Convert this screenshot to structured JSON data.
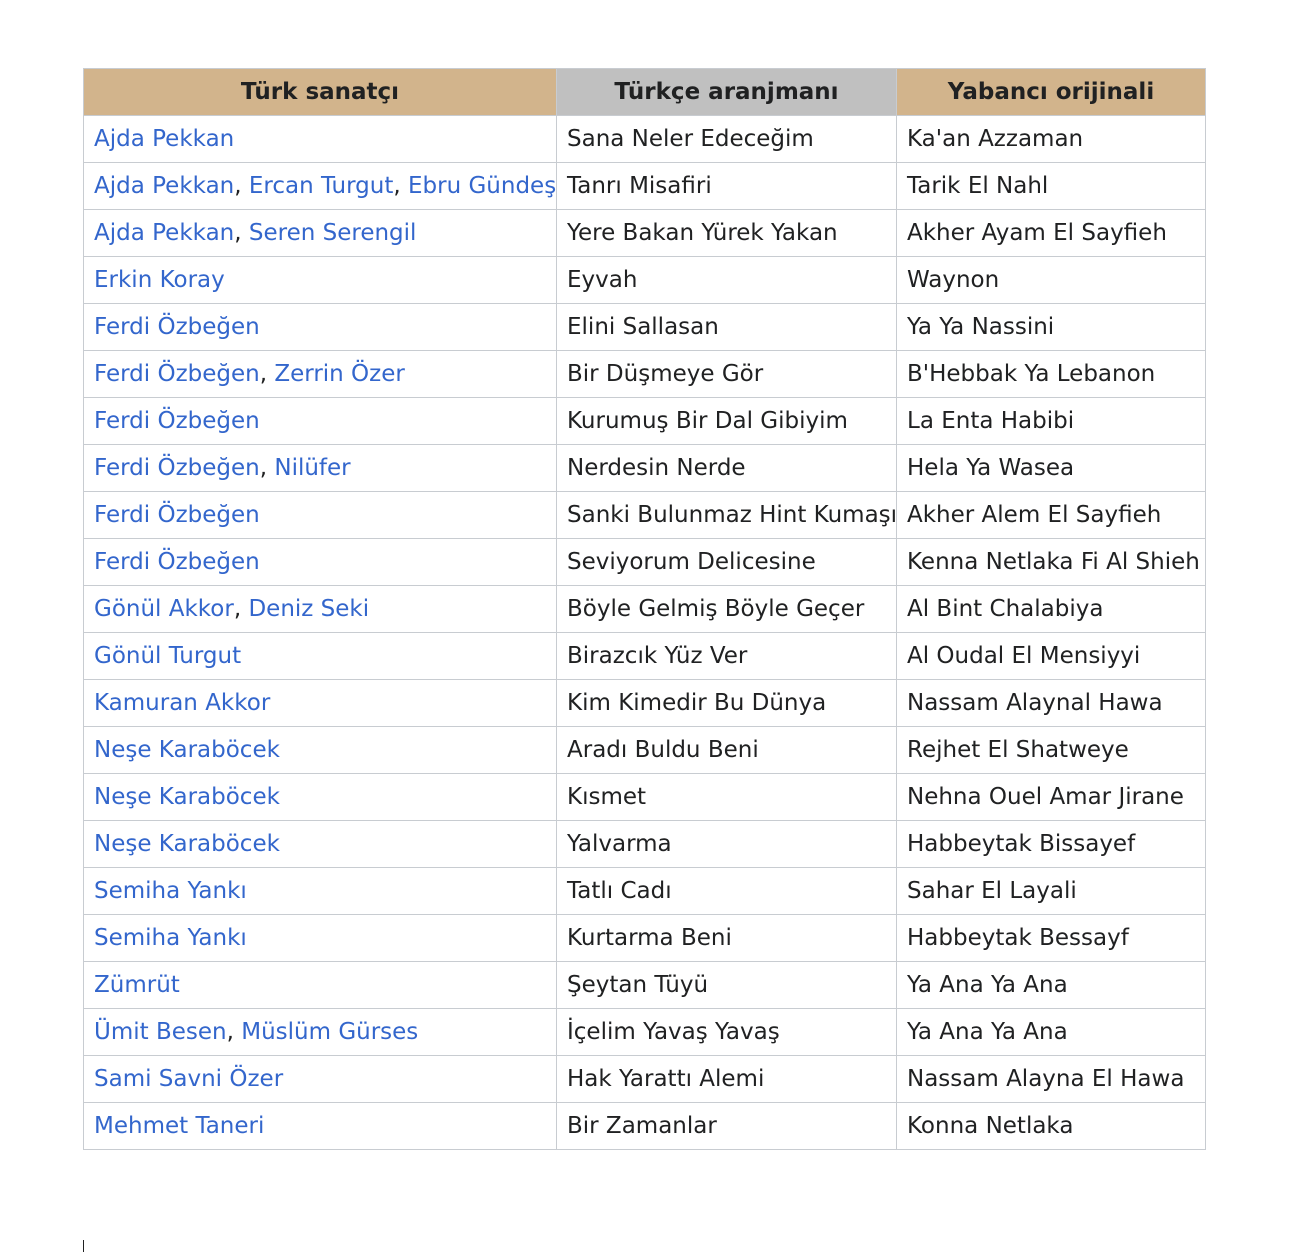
{
  "colors": {
    "header_tan": "#d2b48c",
    "header_gray": "#c0c0c0",
    "link_blue": "#3366cc",
    "text": "#202122",
    "border": "#c8ccd1"
  },
  "table": {
    "headers": [
      "Türk sanatçı",
      "Türkçe aranjmanı",
      "Yabancı orijinali"
    ],
    "rows": [
      {
        "artists": [
          "Ajda Pekkan"
        ],
        "turkish": "Sana Neler Edeceğim",
        "original": "Ka'an Azzaman"
      },
      {
        "artists": [
          "Ajda Pekkan",
          "Ercan Turgut",
          "Ebru Gündeş"
        ],
        "turkish": "Tanrı Misafiri",
        "original": "Tarik El Nahl"
      },
      {
        "artists": [
          "Ajda Pekkan",
          "Seren Serengil"
        ],
        "turkish": "Yere Bakan Yürek Yakan",
        "original": "Akher Ayam El Sayfieh"
      },
      {
        "artists": [
          "Erkin Koray"
        ],
        "turkish": "Eyvah",
        "original": "Waynon"
      },
      {
        "artists": [
          "Ferdi Özbeğen"
        ],
        "turkish": "Elini Sallasan",
        "original": "Ya Ya Nassini"
      },
      {
        "artists": [
          "Ferdi Özbeğen",
          "Zerrin Özer"
        ],
        "turkish": "Bir Düşmeye Gör",
        "original": "B'Hebbak Ya Lebanon"
      },
      {
        "artists": [
          "Ferdi Özbeğen"
        ],
        "turkish": "Kurumuş Bir Dal Gibiyim",
        "original": "La Enta Habibi"
      },
      {
        "artists": [
          "Ferdi Özbeğen",
          "Nilüfer"
        ],
        "turkish": "Nerdesin Nerde",
        "original": "Hela Ya Wasea"
      },
      {
        "artists": [
          "Ferdi Özbeğen"
        ],
        "turkish": "Sanki Bulunmaz Hint Kumaşı",
        "original": "Akher Alem El Sayfieh"
      },
      {
        "artists": [
          "Ferdi Özbeğen"
        ],
        "turkish": "Seviyorum Delicesine",
        "original": "Kenna Netlaka Fi Al Shieh"
      },
      {
        "artists": [
          "Gönül Akkor",
          "Deniz Seki"
        ],
        "turkish": "Böyle Gelmiş Böyle Geçer",
        "original": "Al Bint Chalabiya"
      },
      {
        "artists": [
          "Gönül Turgut"
        ],
        "turkish": "Birazcık Yüz Ver",
        "original": "Al Oudal El Mensiyyi"
      },
      {
        "artists": [
          "Kamuran Akkor"
        ],
        "turkish": "Kim Kimedir Bu Dünya",
        "original": "Nassam Alaynal Hawa"
      },
      {
        "artists": [
          "Neşe Karaböcek"
        ],
        "turkish": "Aradı Buldu Beni",
        "original": "Rejhet El Shatweye"
      },
      {
        "artists": [
          "Neşe Karaböcek"
        ],
        "turkish": "Kısmet",
        "original": "Nehna Ouel Amar Jirane"
      },
      {
        "artists": [
          "Neşe Karaböcek"
        ],
        "turkish": "Yalvarma",
        "original": "Habbeytak Bissayef"
      },
      {
        "artists": [
          "Semiha Yankı"
        ],
        "turkish": "Tatlı Cadı",
        "original": "Sahar El Layali"
      },
      {
        "artists": [
          "Semiha Yankı"
        ],
        "turkish": "Kurtarma Beni",
        "original": "Habbeytak Bessayf"
      },
      {
        "artists": [
          "Zümrüt"
        ],
        "turkish": "Şeytan Tüyü",
        "original": "Ya Ana Ya Ana"
      },
      {
        "artists": [
          "Ümit Besen",
          "Müslüm Gürses"
        ],
        "turkish": "İçelim Yavaş Yavaş",
        "original": "Ya Ana Ya Ana"
      },
      {
        "artists": [
          "Sami Savni Özer"
        ],
        "turkish": "Hak Yarattı Alemi",
        "original": "Nassam Alayna El Hawa"
      },
      {
        "artists": [
          "Mehmet Taneri"
        ],
        "turkish": "Bir Zamanlar",
        "original": "Konna Netlaka"
      }
    ]
  }
}
